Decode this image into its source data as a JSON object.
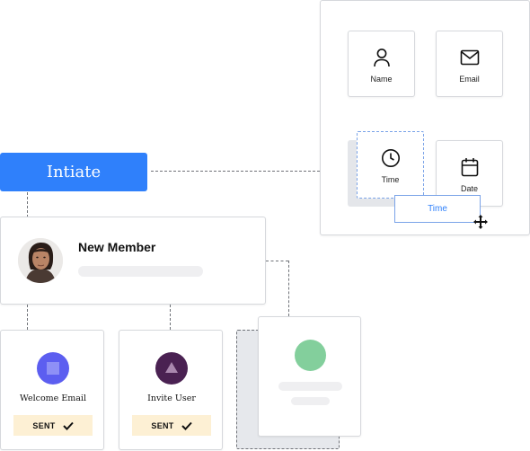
{
  "initiate_button": {
    "label": "Intiate"
  },
  "member_card": {
    "title": "New Member"
  },
  "fields_panel": {
    "name_label": "Name",
    "email_label": "Email",
    "time_label": "Time",
    "date_label": "Date",
    "drag_chip_label": "Time"
  },
  "steps": {
    "welcome": {
      "label": "Welcome Email",
      "status": "SENT"
    },
    "invite": {
      "label": "Invite User",
      "status": "SENT"
    }
  },
  "colors": {
    "primary": "#2f80fb",
    "welcome_circle": "#5c5ef0",
    "invite_circle": "#4a2152",
    "placeholder_circle": "#83cf9c",
    "sent_badge": "#fdf0d4",
    "drag_outline": "#7aa3e8"
  }
}
